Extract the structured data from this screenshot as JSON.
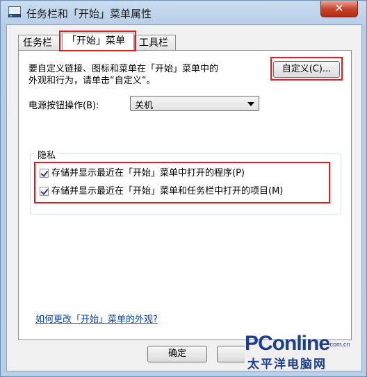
{
  "window": {
    "title": "任务栏和「开始」菜单属性",
    "close_label": "✕"
  },
  "tabs": [
    {
      "label": "任务栏",
      "active": false
    },
    {
      "label": "「开始」菜单",
      "active": true
    },
    {
      "label": "工具栏",
      "active": false
    }
  ],
  "panel": {
    "description_line1": "要自定义链接、图标和菜单在「开始」菜单中的",
    "description_line2": "外观和行为，请单击“自定义”。",
    "customize_button": "自定义(C)...",
    "power_label": "电源按钮操作(B):",
    "power_value": "关机",
    "privacy_group": "隐私",
    "checkbox1": {
      "label": "存储并显示最近在「开始」菜单中打开的程序(P)",
      "checked": true
    },
    "checkbox2": {
      "label": "存储并显示最近在「开始」菜单和任务栏中打开的项目(M)",
      "checked": true
    },
    "help_link": "如何更改「开始」菜单的外观?"
  },
  "footer": {
    "ok_button": "确定"
  },
  "watermark": {
    "logo": "PConline",
    "domain": ".com.cn",
    "chinese": "太平洋电脑网"
  },
  "colors": {
    "highlight": "#e31b23",
    "link": "#0645ad",
    "brand": "#1c3e8f"
  }
}
